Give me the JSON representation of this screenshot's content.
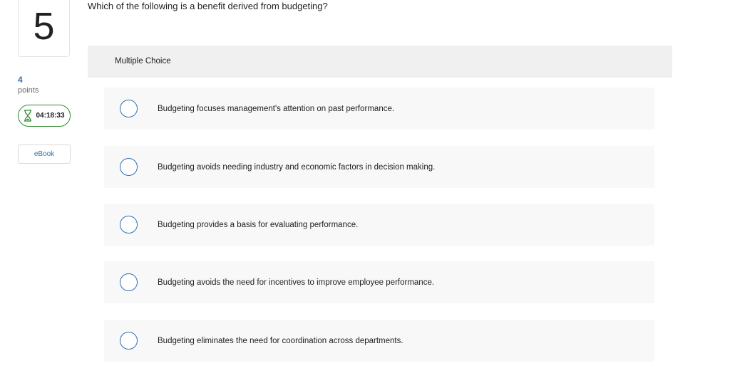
{
  "question_number": "5",
  "points": {
    "value": "4",
    "label": "points"
  },
  "timer": {
    "time": "04:18:33",
    "icon": "hourglass-icon"
  },
  "ebook": {
    "label": "eBook"
  },
  "question": {
    "text": "Which of the following is a benefit derived from budgeting?"
  },
  "choice_section": {
    "label": "Multiple Choice"
  },
  "options": [
    {
      "text": "Budgeting focuses management's attention on past performance."
    },
    {
      "text": "Budgeting avoids needing industry and economic factors in decision making."
    },
    {
      "text": "Budgeting provides a basis for evaluating performance."
    },
    {
      "text": "Budgeting avoids the need for incentives to improve employee performance."
    },
    {
      "text": "Budgeting eliminates the need for coordination across departments."
    }
  ],
  "colors": {
    "accent": "#2f6fb2",
    "timer_border": "#2e8b2e",
    "panel_bg": "#f0f0f0",
    "option_bg": "#f8f8f8"
  }
}
